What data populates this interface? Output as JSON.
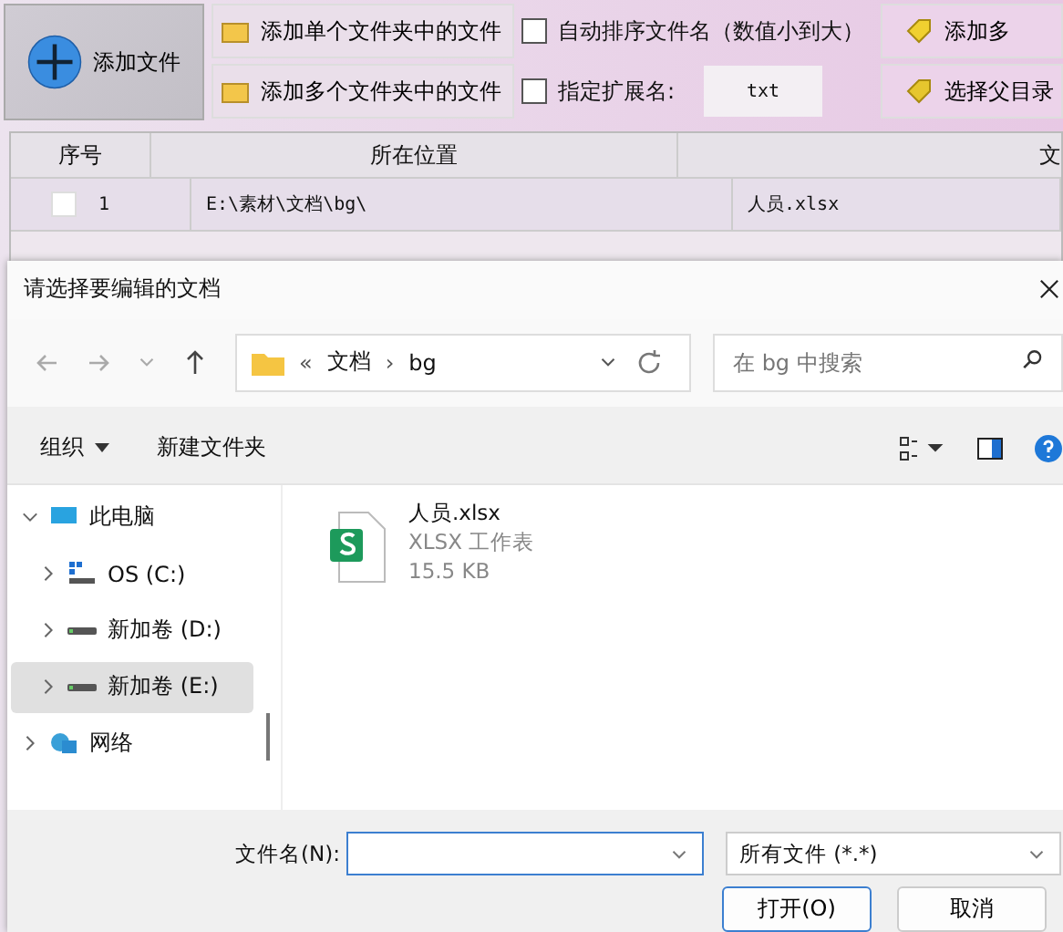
{
  "toolbar": {
    "add_file": "添加文件",
    "add_single": "添加单个文件夹中的文件",
    "add_multi": "添加多个文件夹中的文件",
    "options": [
      {
        "label": "自动排序文件名（数值小到大）",
        "checked": false
      },
      {
        "label": "指定扩展名:",
        "checked": false
      }
    ],
    "extension": "txt",
    "right_buttons": [
      "添加多",
      "选择父目录"
    ]
  },
  "table": {
    "columns": [
      "序号",
      "所在位置",
      "文"
    ],
    "rows": [
      {
        "checked": false,
        "index": "1",
        "location": "E:\\素材\\文档\\bg\\",
        "file": "人员.xlsx"
      }
    ]
  },
  "dialog": {
    "title": "请选择要编辑的文档",
    "path": [
      "«",
      "文档",
      "›",
      "bg"
    ],
    "search": {
      "placeholder": "在 bg 中搜索"
    },
    "organize": "组织",
    "new_folder": "新建文件夹",
    "tree": [
      {
        "label": "此电脑",
        "kind": "pc",
        "expanded": true,
        "selected": false,
        "children": [
          {
            "label": "OS (C:)",
            "kind": "osdrive",
            "expanded": false,
            "selected": false
          },
          {
            "label": "新加卷 (D:)",
            "kind": "drive",
            "expanded": false,
            "selected": false
          },
          {
            "label": "新加卷 (E:)",
            "kind": "drive",
            "expanded": false,
            "selected": true
          }
        ]
      },
      {
        "label": "网络",
        "kind": "network",
        "expanded": false,
        "selected": false
      }
    ],
    "files": [
      {
        "name": "人员.xlsx",
        "type": "XLSX 工作表",
        "size": "15.5 KB"
      }
    ],
    "filename_label": "文件名(N):",
    "filter": "所有文件 (*.*)",
    "buttons": [
      "打开(O)",
      "取消"
    ]
  }
}
